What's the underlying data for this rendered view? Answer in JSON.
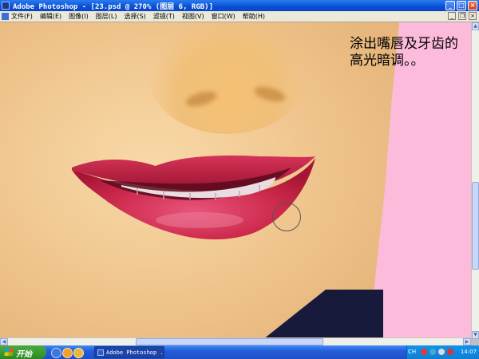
{
  "window": {
    "title": "Adobe Photoshop - [23.psd @ 270% (图层 6, RGB)]",
    "buttons": {
      "minimize": "_",
      "maximize": "□",
      "close": "×"
    }
  },
  "menu": {
    "items": [
      "文件(F)",
      "编辑(E)",
      "图像(I)",
      "图层(L)",
      "选择(S)",
      "滤镜(T)",
      "视图(V)",
      "窗口(W)",
      "帮助(H)"
    ],
    "mdi": {
      "minimize": "_",
      "restore": "❐",
      "close": "×"
    }
  },
  "canvas": {
    "annotation": "涂出嘴唇及牙齿的高光暗调。。",
    "colors": {
      "skin": "#f0c68e",
      "lips": "#c8264a",
      "background": "#fcbbdb",
      "clothing": "#171a3a"
    }
  },
  "taskbar": {
    "start_label": "开始",
    "task_label": "Adobe Photoshop ...",
    "ime": "CH",
    "clock": "14:07"
  }
}
